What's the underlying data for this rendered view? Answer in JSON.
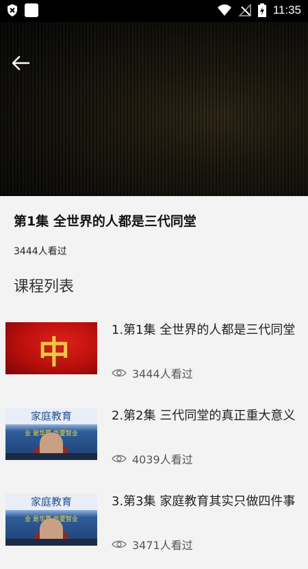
{
  "status_bar": {
    "time": "11:35"
  },
  "episode": {
    "title": "第1集  全世界的人都是三代同堂",
    "views": "3444人看过"
  },
  "section_title": "课程列表",
  "courses": [
    {
      "title": "1.第1集  全世界的人都是三代同堂",
      "views": "3444人看过",
      "thumb_text": "中"
    },
    {
      "title": "2.第2集 三代同堂的真正重大意义",
      "views": "4039人看过",
      "thumb_text": "家庭教育",
      "thumb_sub": "业  是华夏  华夏智业"
    },
    {
      "title": "3.第3集 家庭教育其实只做四件事",
      "views": "3471人看过",
      "thumb_text": "家庭教育",
      "thumb_sub": "业  是华夏  华夏智业"
    }
  ]
}
